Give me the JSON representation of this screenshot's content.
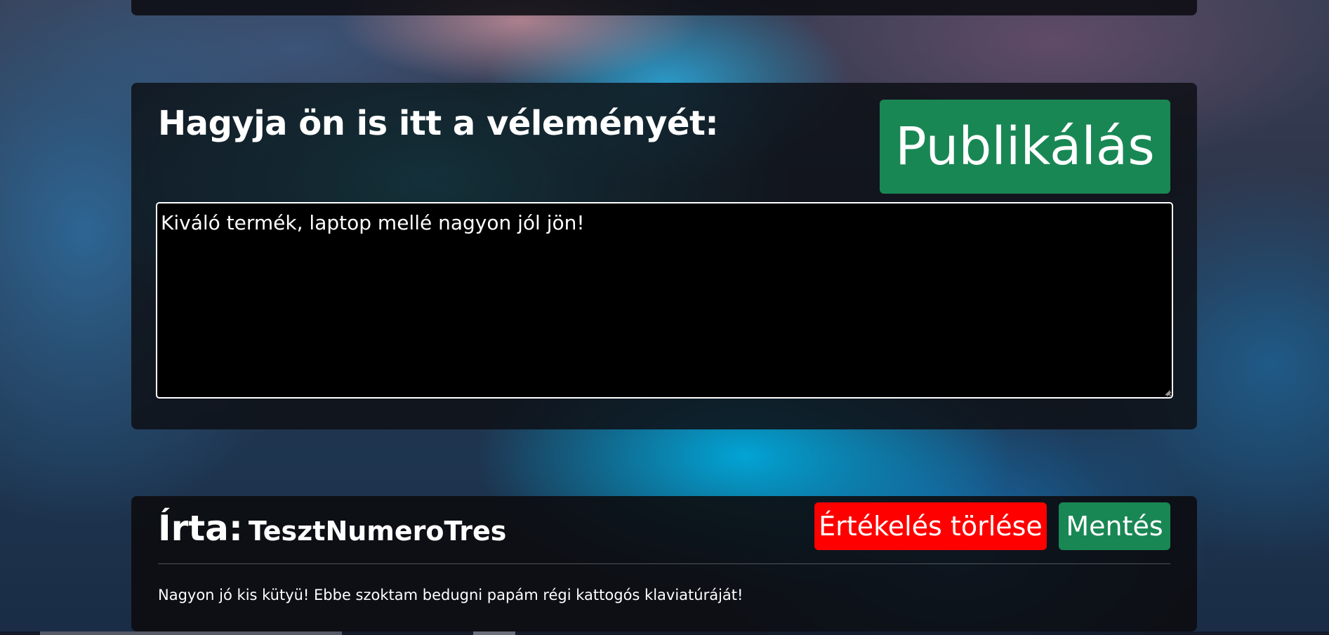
{
  "form": {
    "heading": "Hagyja ön is itt a véleményét:",
    "publish_label": "Publikálás",
    "textarea_value": "Kiváló termék, laptop mellé nagyon jól jön!"
  },
  "review": {
    "author_prefix": "Írta:",
    "author_name": "TesztNumeroTres",
    "delete_label": "Értékelés törlése",
    "save_label": "Mentés",
    "body": "Nagyon jó kis kütyü! Ebbe szoktam bedugni papám régi kattogós klaviatúráját!"
  },
  "colors": {
    "publish": "#198754",
    "save": "#198754",
    "delete": "#ff0000",
    "card_background": "#101218"
  }
}
